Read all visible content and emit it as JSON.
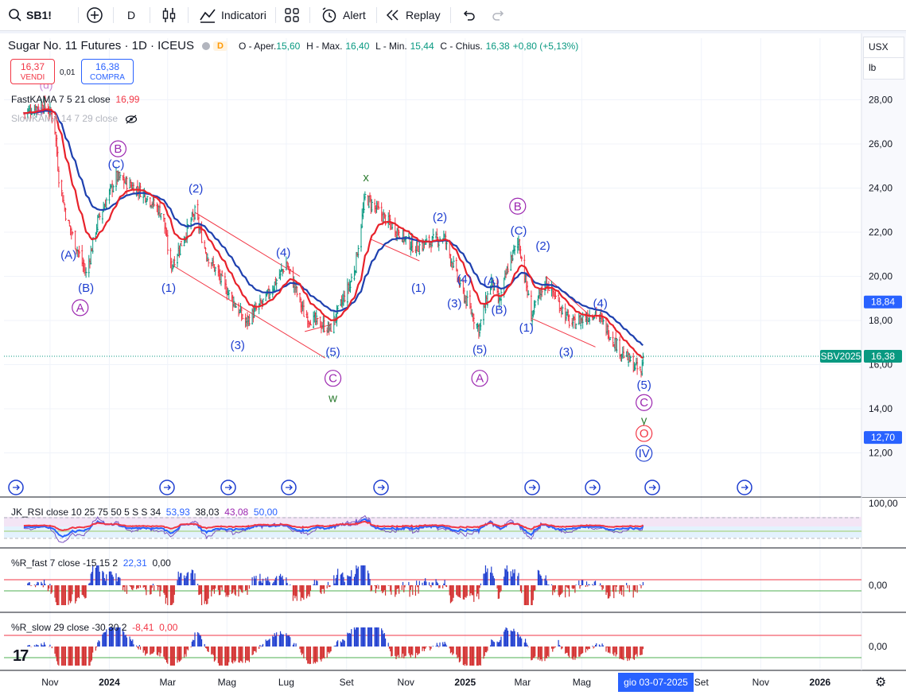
{
  "toolbar": {
    "symbol": "SB1!",
    "interval": "D",
    "indicators_label": "Indicatori",
    "alert_label": "Alert",
    "replay_label": "Replay"
  },
  "legend": {
    "title": "Sugar No. 11 Futures · 1D · ICEUS",
    "badge": "D",
    "open_label": "O - Aper.",
    "open": "15,60",
    "high_label": "H - Max.",
    "high": "16,40",
    "low_label": "L - Min.",
    "low": "15,44",
    "close_label": "C - Chius.",
    "close": "16,38",
    "change": "+0,80 (+5,13%)"
  },
  "trade": {
    "sell_price": "16,37",
    "sell_label": "VENDI",
    "spread": "0,01",
    "buy_price": "16,38",
    "buy_label": "COMPRA"
  },
  "indicators": {
    "fastkama_label": "FastKAMA 7 5 21 close",
    "fastkama_value": "16,99",
    "slowkama_label": "SlowKAMA 14 7 29 close",
    "rsi_label": "JK_RSI close 10 25 75 50 5 S S 34",
    "rsi_values": [
      "53,93",
      "38,03",
      "43,08",
      "50,00"
    ],
    "wr_fast_label": "%R_fast 7 close -15 15 2",
    "wr_fast_values": [
      "22,31",
      "0,00"
    ],
    "wr_slow_label": "%R_slow 29 close -30 30 2",
    "wr_slow_values": [
      "-8,41",
      "0,00"
    ]
  },
  "units": {
    "currency": "USX",
    "unit": "lb"
  },
  "price_axis": {
    "ticks": [
      "28,00",
      "26,00",
      "24,00",
      "22,00",
      "20,00",
      "18,00",
      "16,00",
      "14,00",
      "12,00"
    ],
    "badges": [
      {
        "text": "18,84",
        "color": "#2962ff"
      },
      {
        "text": "SBV2025",
        "color": "#089981"
      },
      {
        "text": "16,38",
        "color": "#089981"
      },
      {
        "text": "12,70",
        "color": "#2962ff"
      }
    ]
  },
  "pane_axes": {
    "rsi_top": "100,00",
    "wr_fast_zero": "0,00",
    "wr_slow_zero": "0,00"
  },
  "time_axis": {
    "labels": [
      "Nov",
      "2024",
      "Mar",
      "Mag",
      "Lug",
      "Set",
      "Nov",
      "2025",
      "Mar",
      "Mag",
      "Set",
      "Nov",
      "2026"
    ],
    "crosshair_date": "gio 03-07-2025"
  },
  "colors": {
    "up": "#089981",
    "down": "#f23645",
    "fast_kama": "#e8222b",
    "slow_kama": "#1e40af",
    "wave_blue": "#1e3ed0",
    "wave_purple": "#9c27b0",
    "wave_green": "#2e7d32",
    "trend_line": "#f23645"
  },
  "wave_labels": [
    "(A)",
    "(B)",
    "(C)",
    "A",
    "B",
    "(1)",
    "(2)",
    "(3)",
    "(4)",
    "(5)",
    "C",
    "w",
    "x",
    "(1)",
    "(2)",
    "(3)",
    "(4)",
    "(5)",
    "(A)",
    "(B)",
    "(C)",
    "(3)",
    "(4)",
    "(5)",
    "A",
    "B",
    "(1)",
    "(2)",
    "(3)",
    "(4)",
    "(5)",
    "C",
    "y",
    "O",
    "IV",
    "(d)",
    "5"
  ],
  "chart_data": {
    "type": "candlestick",
    "title": "Sugar No. 11 Futures · 1D · ICEUS",
    "ylabel": "USX / lb",
    "ylim": [
      11,
      29
    ],
    "x_range": [
      "2023-10-01",
      "2026-03-01"
    ],
    "price_path": [
      {
        "date": "2023-10-05",
        "price": 27.4
      },
      {
        "date": "2023-10-25",
        "price": 27.8
      },
      {
        "date": "2023-11-05",
        "price": 27.2
      },
      {
        "date": "2023-11-10",
        "price": 24.5
      },
      {
        "date": "2023-11-18",
        "price": 22.6
      },
      {
        "date": "2023-12-08",
        "price": 20.1
      },
      {
        "date": "2023-12-20",
        "price": 22.5
      },
      {
        "date": "2024-01-08",
        "price": 24.5
      },
      {
        "date": "2024-02-05",
        "price": 23.8
      },
      {
        "date": "2024-02-25",
        "price": 22.8
      },
      {
        "date": "2024-03-04",
        "price": 20.4
      },
      {
        "date": "2024-03-29",
        "price": 22.9
      },
      {
        "date": "2024-04-10",
        "price": 21.0
      },
      {
        "date": "2024-05-20",
        "price": 17.9
      },
      {
        "date": "2024-06-10",
        "price": 19.0
      },
      {
        "date": "2024-07-01",
        "price": 20.6
      },
      {
        "date": "2024-07-20",
        "price": 18.2
      },
      {
        "date": "2024-08-15",
        "price": 17.6
      },
      {
        "date": "2024-09-04",
        "price": 19.6
      },
      {
        "date": "2024-09-10",
        "price": 20.5
      },
      {
        "date": "2024-09-20",
        "price": 23.6
      },
      {
        "date": "2024-10-15",
        "price": 22.4
      },
      {
        "date": "2024-11-10",
        "price": 21.3
      },
      {
        "date": "2024-12-10",
        "price": 21.8
      },
      {
        "date": "2024-12-28",
        "price": 19.4
      },
      {
        "date": "2025-01-15",
        "price": 17.6
      },
      {
        "date": "2025-01-28",
        "price": 19.8
      },
      {
        "date": "2025-02-05",
        "price": 18.8
      },
      {
        "date": "2025-02-15",
        "price": 20.6
      },
      {
        "date": "2025-02-25",
        "price": 21.6
      },
      {
        "date": "2025-03-10",
        "price": 18.2
      },
      {
        "date": "2025-03-25",
        "price": 19.8
      },
      {
        "date": "2025-04-20",
        "price": 17.8
      },
      {
        "date": "2025-05-15",
        "price": 18.4
      },
      {
        "date": "2025-06-10",
        "price": 16.6
      },
      {
        "date": "2025-07-01",
        "price": 15.6
      },
      {
        "date": "2025-07-03",
        "price": 16.38
      }
    ],
    "series": [
      {
        "name": "FastKAMA 7 5 21 close",
        "last": 16.99
      },
      {
        "name": "SlowKAMA 14 7 29 close"
      }
    ],
    "grid": true
  }
}
